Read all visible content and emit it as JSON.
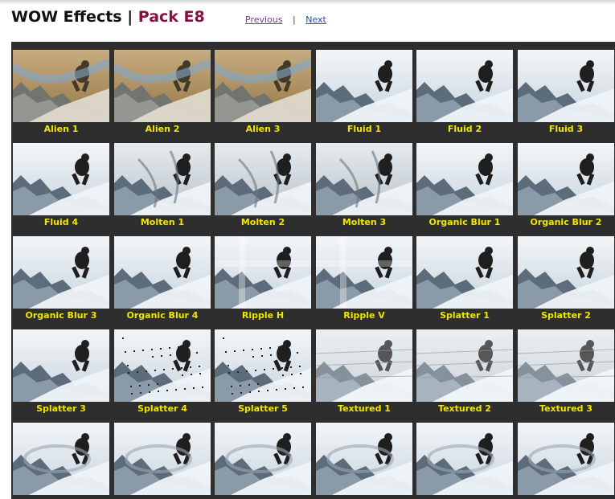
{
  "header": {
    "title_main": "WOW Effects",
    "title_separator": "|",
    "title_pack": "Pack E8",
    "nav_previous": "Previous",
    "nav_separator": "|",
    "nav_next": "Next"
  },
  "colors": {
    "panel_bg": "#2e2e2e",
    "label": "#f2e600",
    "pack_title": "#8a0f42"
  },
  "effects": [
    {
      "label": "Alien 1",
      "style": "alien"
    },
    {
      "label": "Alien 2",
      "style": "alien"
    },
    {
      "label": "Alien 3",
      "style": "alien"
    },
    {
      "label": "Fluid 1",
      "style": "normal"
    },
    {
      "label": "Fluid 2",
      "style": "normal"
    },
    {
      "label": "Fluid 3",
      "style": "normal"
    },
    {
      "label": "Fluid 4",
      "style": "normal"
    },
    {
      "label": "Molten 1",
      "style": "molten"
    },
    {
      "label": "Molten 2",
      "style": "molten"
    },
    {
      "label": "Molten 3",
      "style": "molten"
    },
    {
      "label": "Organic Blur 1",
      "style": "normal"
    },
    {
      "label": "Organic Blur 2",
      "style": "normal"
    },
    {
      "label": "Organic Blur 3",
      "style": "normal"
    },
    {
      "label": "Organic Blur 4",
      "style": "normal"
    },
    {
      "label": "Ripple H",
      "style": "ripple"
    },
    {
      "label": "Ripple V",
      "style": "ripple"
    },
    {
      "label": "Splatter 1",
      "style": "normal"
    },
    {
      "label": "Splatter 2",
      "style": "normal"
    },
    {
      "label": "Splatter 3",
      "style": "normal"
    },
    {
      "label": "Splatter 4",
      "style": "splatter"
    },
    {
      "label": "Splatter 5",
      "style": "splatter"
    },
    {
      "label": "Textured 1",
      "style": "textured"
    },
    {
      "label": "Textured 2",
      "style": "textured"
    },
    {
      "label": "Textured 3",
      "style": "textured"
    },
    {
      "label": "",
      "style": "warp"
    },
    {
      "label": "",
      "style": "warp"
    },
    {
      "label": "",
      "style": "warp"
    },
    {
      "label": "",
      "style": "warp"
    },
    {
      "label": "",
      "style": "warp"
    },
    {
      "label": "",
      "style": "warp"
    }
  ]
}
